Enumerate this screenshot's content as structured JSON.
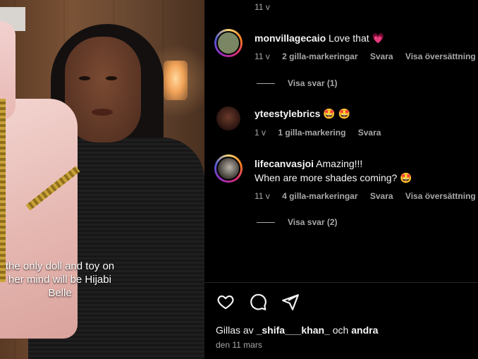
{
  "video": {
    "caption": "the only doll and toy on her mind will be Hijabi Belle"
  },
  "comments_panel": {
    "top_meta": "11 v",
    "comments": [
      {
        "username": "monvillagecaio",
        "text": "Love that",
        "emoji": "💗",
        "time": "11 v",
        "likes": "2 gilla-markeringar",
        "reply": "Svara",
        "translate": "Visa översättning",
        "view_replies": "Visa svar (1)"
      },
      {
        "username": "yteestylebrics",
        "text": "",
        "emoji": "🤩 🤩",
        "time": "1 v",
        "likes": "1 gilla-markering",
        "reply": "Svara"
      },
      {
        "username": "lifecanvasjoi",
        "text": "Amazing!!!",
        "text_line2": "When are more shades coming?",
        "emoji": "🤩",
        "time": "11 v",
        "likes": "4 gilla-markeringar",
        "reply": "Svara",
        "translate": "Visa översättning",
        "view_replies": "Visa svar (2)"
      }
    ]
  },
  "footer": {
    "liked_by_prefix": "Gillas av",
    "liked_by_user": "_shifa___khan_",
    "liked_by_middle": "och",
    "liked_by_others": "andra",
    "date": "den 11 mars"
  },
  "icons": {
    "like": "heart-icon",
    "comment": "comment-icon",
    "share": "send-icon"
  },
  "colors": {
    "background": "#000000",
    "muted_text": "#a8a8a8",
    "heart_emoji": "#ff3b6b"
  }
}
